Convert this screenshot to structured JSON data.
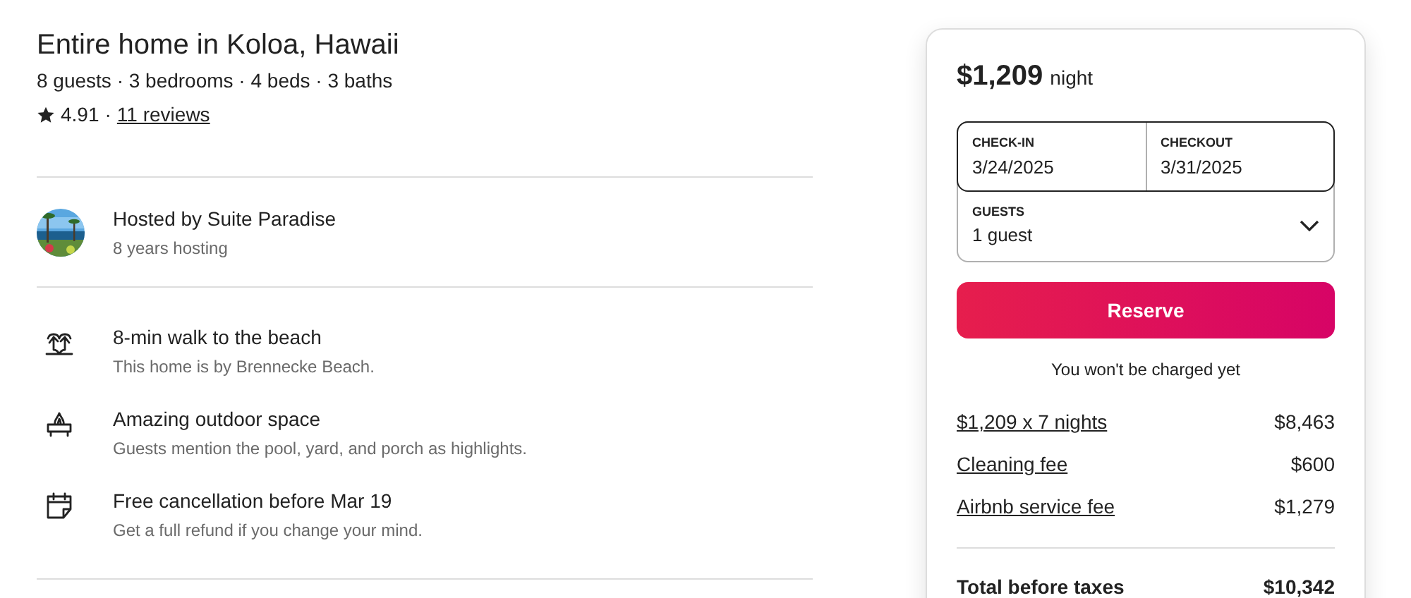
{
  "listing": {
    "title": "Entire home in Koloa, Hawaii",
    "details": "8 guests · 3 bedrooms · 4 beds · 3 baths",
    "rating": "4.91",
    "separator": "·",
    "reviews": "11 reviews"
  },
  "host": {
    "name": "Hosted by Suite Paradise",
    "tenure": "8 years hosting"
  },
  "highlights": [
    {
      "kind": "beach",
      "title": "8-min walk to the beach",
      "detail": "This home is by Brennecke Beach."
    },
    {
      "kind": "outdoor",
      "title": "Amazing outdoor space",
      "detail": "Guests mention the pool, yard, and porch as highlights."
    },
    {
      "kind": "calendar",
      "title": "Free cancellation before Mar 19",
      "detail": "Get a full refund if you change your mind."
    }
  ],
  "booking": {
    "price": "$1,209",
    "unit": "night",
    "dates": [
      {
        "label": "CHECK-IN",
        "value": "3/24/2025"
      },
      {
        "label": "CHECKOUT",
        "value": "3/31/2025"
      }
    ],
    "guests": {
      "label": "GUESTS",
      "value": "1 guest"
    },
    "reserve": "Reserve",
    "note": "You won't be charged yet",
    "fees": [
      {
        "label": "$1,209 x 7 nights",
        "amount": "$8,463"
      },
      {
        "label": "Cleaning fee",
        "amount": "$600"
      },
      {
        "label": "Airbnb service fee",
        "amount": "$1,279"
      }
    ],
    "total": {
      "label": "Total before taxes",
      "amount": "$10,342"
    }
  }
}
